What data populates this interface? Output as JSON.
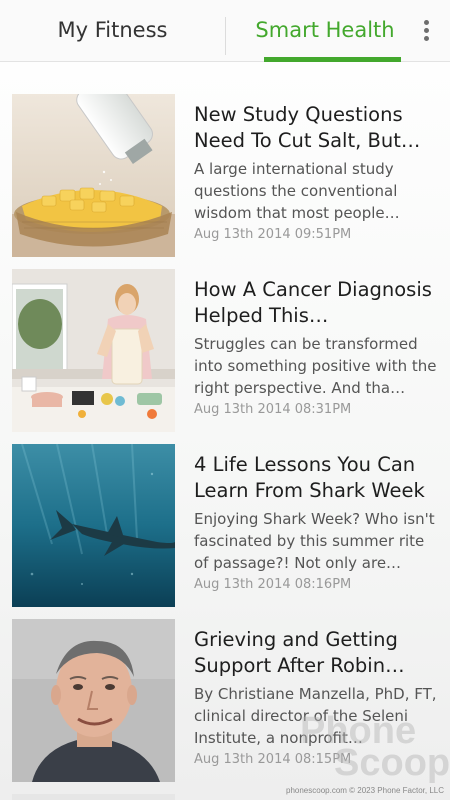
{
  "tabs": {
    "my_fitness": "My Fitness",
    "smart_health": "Smart Health",
    "active": "smart_health"
  },
  "menu_icon": "overflow-menu-icon",
  "accent_color": "#43a82d",
  "articles": [
    {
      "title": "New Study Questions Need To Cut Salt, But…",
      "description": "A large international study questions the conventional wisdom that most people…",
      "date": "Aug 13th 2014 09:51PM",
      "image": "salt-on-potatoes"
    },
    {
      "title": "How A Cancer Diagnosis Helped This…",
      "description": "Struggles can be transformed into something positive with the right perspective. And tha…",
      "date": "Aug 13th 2014 08:31PM",
      "image": "woman-cooking-kitchen"
    },
    {
      "title": "4 Life Lessons You Can Learn From Shark Week",
      "description": "Enjoying Shark Week? Who isn't fascinated by this summer rite of passage?! Not only are…",
      "date": "Aug 13th 2014 08:16PM",
      "image": "shark-underwater"
    },
    {
      "title": "Grieving and Getting Support After Robin…",
      "description": "By Christiane Manzella, PhD, FT, clinical director of the Seleni Institute, a nonprofit…",
      "date": "Aug 13th 2014 08:15PM",
      "image": "man-portrait"
    }
  ],
  "watermark": {
    "line1": "Phone",
    "line2": "Scoop"
  },
  "footer": "phonescoop.com  © 2023 Phone Factor, LLC"
}
